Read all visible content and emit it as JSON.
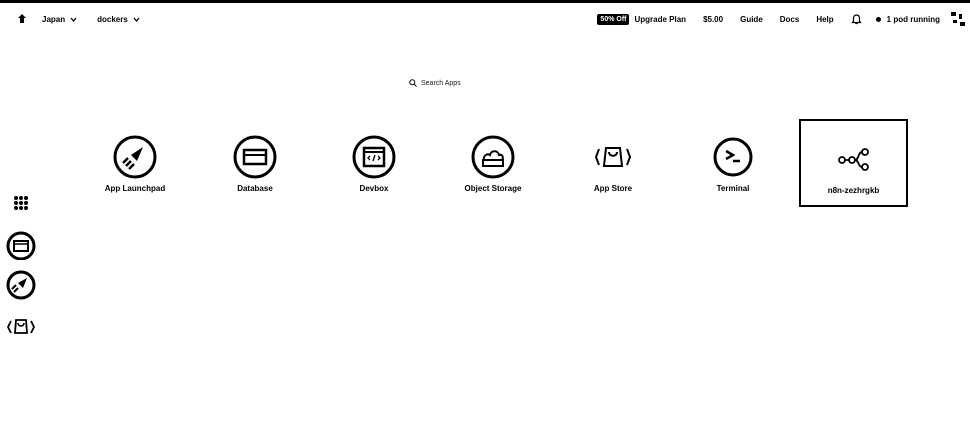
{
  "topbar": {
    "region": "Japan",
    "workspace": "dockers",
    "badge": "50% Off",
    "upgrade": "Upgrade Plan",
    "balance": "$5.00",
    "links": [
      "Guide",
      "Docs",
      "Help"
    ],
    "pods": "1 pod running"
  },
  "search": {
    "label": "Search Apps"
  },
  "apps": [
    {
      "label": "App Launchpad",
      "icon": "rocket-icon"
    },
    {
      "label": "Database",
      "icon": "database-icon"
    },
    {
      "label": "Devbox",
      "icon": "devbox-icon"
    },
    {
      "label": "Object Storage",
      "icon": "cloud-storage-icon"
    },
    {
      "label": "App Store",
      "icon": "app-store-icon"
    },
    {
      "label": "Terminal",
      "icon": "terminal-icon"
    },
    {
      "label": "n8n-zezhrgkb",
      "icon": "workflow-icon"
    }
  ],
  "dock": {
    "items": [
      "apps-grid-icon",
      "database-icon",
      "rocket-icon",
      "app-store-icon"
    ]
  }
}
